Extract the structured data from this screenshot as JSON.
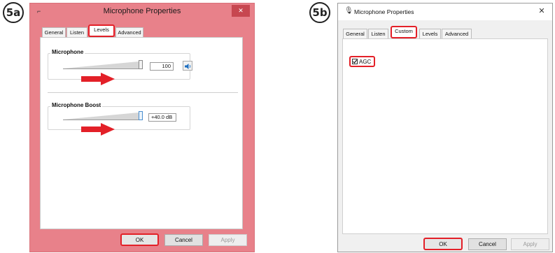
{
  "step_a": {
    "label": "5a"
  },
  "step_b": {
    "label": "5b"
  },
  "dialog_a": {
    "title": "Microphone Properties",
    "close_glyph": "✕",
    "colors": {
      "titlebar": "#e8818a",
      "close": "#c74750",
      "border": "#d9717a",
      "highlight": "#e32028"
    },
    "tabs": [
      "General",
      "Listen",
      "Levels",
      "Advanced"
    ],
    "active_tab": "Levels",
    "microphone": {
      "label": "Microphone",
      "value": "100",
      "level_percent": 100
    },
    "boost": {
      "label": "Microphone Boost",
      "value": "+40.0 dB",
      "level_percent": 100
    },
    "buttons": {
      "ok": "OK",
      "cancel": "Cancel",
      "apply": "Apply"
    }
  },
  "dialog_b": {
    "title": "Microphone Properties",
    "close_glyph": "✕",
    "tabs": [
      "General",
      "Listen",
      "Custom",
      "Levels",
      "Advanced"
    ],
    "active_tab": "Custom",
    "agc": {
      "label": "AGC",
      "checked": true
    },
    "buttons": {
      "ok": "OK",
      "cancel": "Cancel",
      "apply": "Apply"
    }
  },
  "icons": {
    "mic": "microphone-icon",
    "speaker": "speaker-icon",
    "arrow": "right-arrow-icon"
  }
}
